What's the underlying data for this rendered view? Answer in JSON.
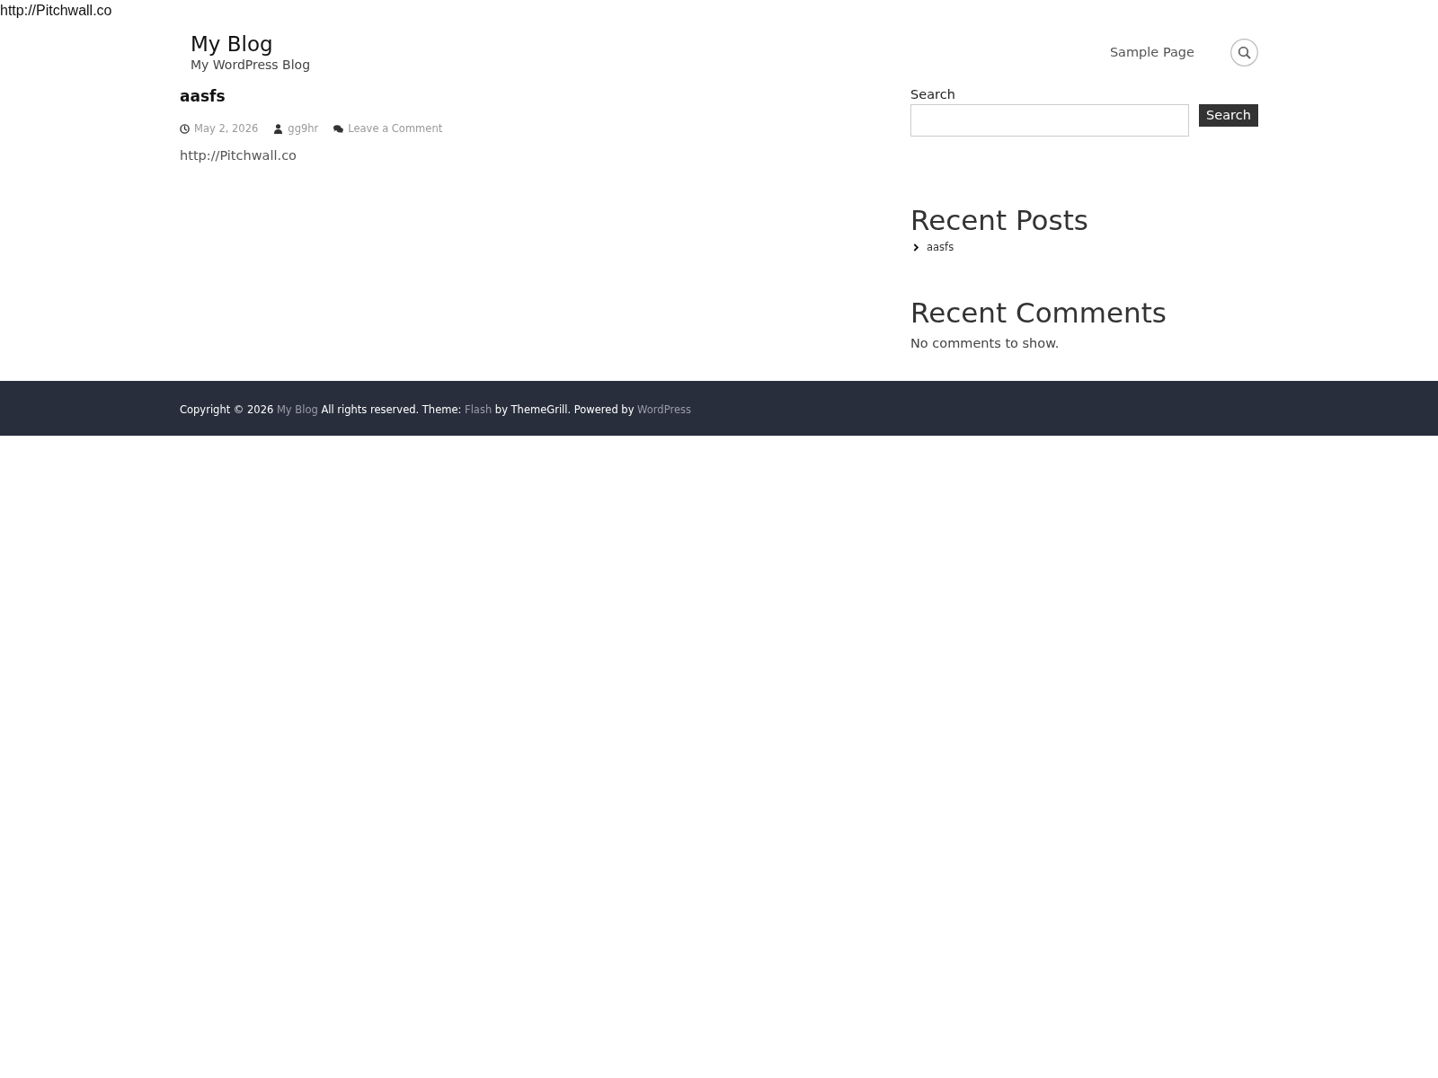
{
  "page_top_text": "http://Pitchwall.co",
  "header": {
    "site_title": "My Blog",
    "tagline": "My WordPress Blog",
    "nav": [
      {
        "label": "Sample Page"
      }
    ]
  },
  "post": {
    "title": "aasfs",
    "meta": [
      {
        "kind": "date",
        "text": "May 2, 2026"
      },
      {
        "kind": "author",
        "text": "gg9hr"
      },
      {
        "kind": "comments",
        "text": "Leave a Comment"
      }
    ],
    "content": "http://Pitchwall.co"
  },
  "sidebar": {
    "search": {
      "label": "Search",
      "button": "Search"
    },
    "recent_posts": {
      "title": "Recent Posts",
      "items": [
        "aasfs"
      ]
    },
    "recent_comments": {
      "title": "Recent Comments",
      "empty_text": "No comments to show."
    }
  },
  "footer": {
    "segments": [
      {
        "kind": "text",
        "text": "Copyright © 2026 "
      },
      {
        "kind": "link",
        "text": "My Blog"
      },
      {
        "kind": "text",
        "text": " All rights reserved. Theme: "
      },
      {
        "kind": "link",
        "text": "Flash"
      },
      {
        "kind": "text",
        "text": " by ThemeGrill. Powered by "
      },
      {
        "kind": "link",
        "text": "WordPress"
      }
    ]
  }
}
